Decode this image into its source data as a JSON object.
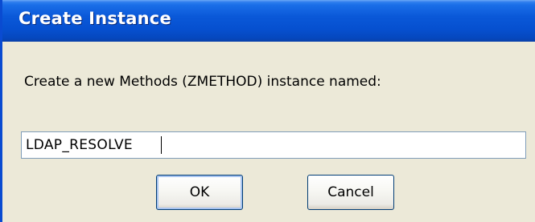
{
  "window": {
    "title": "Create Instance"
  },
  "dialog": {
    "prompt": "Create a new Methods (ZMETHOD) instance named:",
    "name_value": "LDAP_RESOLVE",
    "ok_label": "OK",
    "cancel_label": "Cancel"
  },
  "colors": {
    "titlebar": "#0650d0",
    "dialog_bg": "#ece9d8",
    "input_border": "#7f9db9",
    "button_border": "#003c74"
  }
}
